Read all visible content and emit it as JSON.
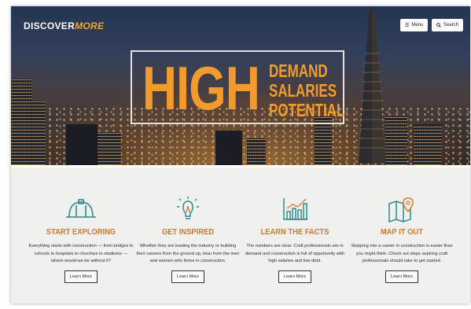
{
  "header": {
    "logo_main": "DISCOVER",
    "logo_accent": "MORE",
    "menu_label": "Menu",
    "search_label": "Search",
    "menu_icon": "hamburger-icon",
    "search_icon": "search-icon"
  },
  "hero": {
    "big_word": "HIGH",
    "line1": "DEMAND",
    "line2": "SALARIES",
    "line3": "POTENTIAL",
    "accent_color": "#f39a2c"
  },
  "features": [
    {
      "icon": "hard-hat-icon",
      "title": "START EXPLORING",
      "text": "Everything starts with construction — from bridges to schools to hospitals to churches to stadiums — where would we be without it?",
      "button": "Learn More"
    },
    {
      "icon": "lightbulb-icon",
      "title": "GET INSPIRED",
      "text": "Whether they are leading the industry or building their careers from the ground up, hear from the men and women who thrive in construction.",
      "button": "Learn More"
    },
    {
      "icon": "bar-chart-icon",
      "title": "LEARN THE FACTS",
      "text": "The numbers are clear. Craft professionals are in demand and construction is full of opportunity with high salaries and low debt.",
      "button": "Learn More"
    },
    {
      "icon": "map-pin-icon",
      "title": "MAP IT OUT",
      "text": "Stepping into a career in construction is easier than you might think. Check out steps aspiring craft professionals should take to get started.",
      "button": "Learn More"
    }
  ],
  "colors": {
    "title_orange": "#e2732a",
    "icon_teal": "#2c8c8c"
  }
}
